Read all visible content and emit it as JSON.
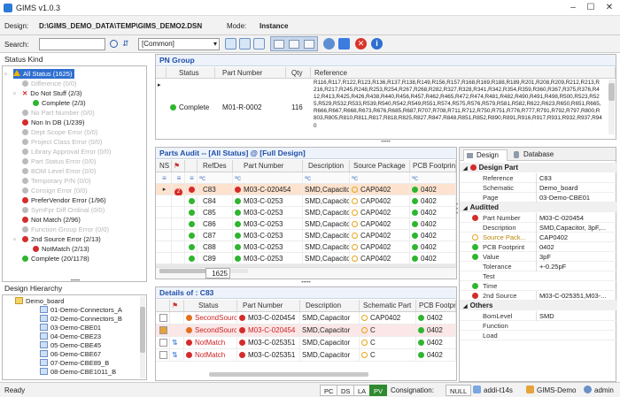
{
  "window": {
    "title": "GIMS v1.0.3"
  },
  "info": {
    "design_label": "Design:",
    "design_path": "D:\\GIMS_DEMO_DATA\\TEMP\\GIMS_DEMO2.DSN",
    "mode_label": "Mode:",
    "mode_value": "Instance"
  },
  "search": {
    "label": "Search:",
    "value": "",
    "scope": "[Common]"
  },
  "status_kind": {
    "title": "Status Kind",
    "items": [
      {
        "label": "All Status (1625)",
        "icon": "warning",
        "dim": false
      },
      {
        "label": "Difference (0/0)",
        "icon": "dot-orange",
        "dim": true
      },
      {
        "label": "Do Not Stuff (2/3)",
        "icon": "x-mark",
        "dim": false
      },
      {
        "label": "Complete (2/3)",
        "icon": "dot-green",
        "dim": false
      },
      {
        "label": "No Part Number (0/0)",
        "icon": "dot-red",
        "dim": true
      },
      {
        "label": "Non In DB (1/239)",
        "icon": "dot-red",
        "dim": false
      },
      {
        "label": "Dept Scope Error (0/0)",
        "icon": "dot-red",
        "dim": true
      },
      {
        "label": "Project Class Error (0/0)",
        "icon": "dot-red",
        "dim": true
      },
      {
        "label": "Library Approval Error (0/0)",
        "icon": "dot-red",
        "dim": true
      },
      {
        "label": "Part Status Error (0/0)",
        "icon": "dot-red",
        "dim": true
      },
      {
        "label": "BOM Level Error (0/0)",
        "icon": "dot-red",
        "dim": true
      },
      {
        "label": "Temporary P/N (0/0)",
        "icon": "dot-red",
        "dim": true
      },
      {
        "label": "Consign Error (0/0)",
        "icon": "dot-red",
        "dim": true
      },
      {
        "label": "PreferVendor Error (1/96)",
        "icon": "dot-red",
        "dim": false
      },
      {
        "label": "SymFpr Diff Ordinal (0/0)",
        "icon": "dot-red",
        "dim": true
      },
      {
        "label": "Not Match (2/96)",
        "icon": "dot-red",
        "dim": false
      },
      {
        "label": "Function Group Error (0/0)",
        "icon": "dot-red",
        "dim": true
      },
      {
        "label": "2nd Source Error (2/13)",
        "icon": "dot-red",
        "dim": false
      },
      {
        "label": "NotMatch (2/13)",
        "icon": "dot-red",
        "dim": false
      },
      {
        "label": "Complete (20/1178)",
        "icon": "dot-green",
        "dim": false
      }
    ]
  },
  "design_hierarchy": {
    "title": "Design Hierarchy",
    "items": [
      "Demo_board",
      "01-Demo-Connectors_A",
      "02-Demo-Connectors_B",
      "03-Demo-CBE01",
      "04-Demo-CBE23",
      "05-Demo-CBE45",
      "06-Demo-CBE67",
      "07-Demo-CBE89_B",
      "08-Demo-CBE1011_B"
    ]
  },
  "pn_group": {
    "title": "PN Group",
    "headers": [
      "Status",
      "Part Number",
      "Qty",
      "Reference"
    ],
    "row": {
      "status": "Complete",
      "part_number": "M01-R-0002",
      "qty": "116",
      "reference": "R116,R117,R122,R123,R136,R137,R138,R149,R156,R157,R168,R169,R188,R189,R201,R208,R209,R212,R213,R216,R217,R245,R248,R253,R254,R267,R268,R282,R327,R328,R341,R342,R354,R359,R360,R367,R375,R376,R412,R413,R425,R426,R438,R440,R456,R457,R462,R465,R472,R474,R481,R482,R490,R491,R498,R500,R523,R525,R529,R532,R533,R539,R540,R542,R549,R551,R574,R575,R576,R579,R581,R582,R622,R623,R650,R651,R665,R666,R667,R668,R673,R676,R685,R687,R707,R708,R711,R712,R750,R751,R776,R777,R791,R792,R797,R800,R803,R805,R810,R811,R817,R818,R825,R827,R847,R848,R851,R852,R890,R891,R916,R917,R931,R932,R937,R940"
    }
  },
  "parts_audit": {
    "title": "Parts Audit -- [All Status] @ [Full Design]",
    "headers": [
      "NS",
      "RefDes",
      "Part Number",
      "Description",
      "Source Package",
      "PCB Footprint"
    ],
    "rows": [
      {
        "ns": "2",
        "refdes": "C83",
        "part": "M03-C-020454",
        "desc": "SMD,Capacitor",
        "pkg": "CAP0402",
        "fp": "0402",
        "status": "red",
        "selected": true
      },
      {
        "ns": "",
        "refdes": "C84",
        "part": "M03-C-0253",
        "desc": "SMD,Capacitor",
        "pkg": "CAP0402",
        "fp": "0402",
        "status": "green",
        "selected": false
      },
      {
        "ns": "",
        "refdes": "C85",
        "part": "M03-C-0253",
        "desc": "SMD,Capacitor",
        "pkg": "CAP0402",
        "fp": "0402",
        "status": "green",
        "selected": false
      },
      {
        "ns": "",
        "refdes": "C86",
        "part": "M03-C-0253",
        "desc": "SMD,Capacitor",
        "pkg": "CAP0402",
        "fp": "0402",
        "status": "green",
        "selected": false
      },
      {
        "ns": "",
        "refdes": "C87",
        "part": "M03-C-0253",
        "desc": "SMD,Capacitor",
        "pkg": "CAP0402",
        "fp": "0402",
        "status": "green",
        "selected": false
      },
      {
        "ns": "",
        "refdes": "C88",
        "part": "M03-C-0253",
        "desc": "SMD,Capacitor",
        "pkg": "CAP0402",
        "fp": "0402",
        "status": "green",
        "selected": false
      },
      {
        "ns": "",
        "refdes": "C89",
        "part": "M03-C-0253",
        "desc": "SMD,Capacitor",
        "pkg": "CAP0402",
        "fp": "0402",
        "status": "green",
        "selected": false
      }
    ],
    "count": "1625"
  },
  "details": {
    "title": "Details of : C83",
    "headers": [
      "Status",
      "Part Number",
      "Description",
      "Schematic Part",
      "PCB Footprint"
    ],
    "rows": [
      {
        "status": "SecondSource",
        "part": "M03-C-020454",
        "desc": "SMD,Capacitor",
        "schpart": "CAP0402",
        "fp": "0402",
        "highlight": false
      },
      {
        "status": "SecondSource",
        "part": "M03-C-020454",
        "desc": "SMD,Capacitor",
        "schpart": "C",
        "fp": "0402",
        "highlight": true
      },
      {
        "status": "NotMatch",
        "part": "M03-C-025351",
        "desc": "SMD,Capacitor",
        "schpart": "C",
        "fp": "0402",
        "highlight": false
      },
      {
        "status": "NotMatch",
        "part": "M03-C-025351",
        "desc": "SMD,Capacitor",
        "schpart": "C",
        "fp": "0402",
        "highlight": false
      }
    ]
  },
  "props": {
    "tabs": [
      "Design",
      "Database"
    ],
    "design_part": {
      "title": "Design Part",
      "rows": [
        [
          "Reference",
          "C83"
        ],
        [
          "Schematic",
          "Demo_board"
        ],
        [
          "Page",
          "03-Demo-CBE01"
        ]
      ]
    },
    "auditted": {
      "title": "Auditted",
      "rows": [
        [
          "Part Number",
          "M03-C-020454"
        ],
        [
          "Description",
          "SMD,Capacitor, 3pF,..."
        ],
        [
          "Source Pack...",
          "CAP0402"
        ],
        [
          "PCB Footprint",
          "0402"
        ],
        [
          "Value",
          "3pF"
        ],
        [
          "Tolerance",
          "+-0.25pF"
        ],
        [
          "Test",
          ""
        ],
        [
          "Time",
          ""
        ],
        [
          "2nd Source",
          "M03-C-025351,M03-..."
        ]
      ]
    },
    "others": {
      "title": "Others",
      "rows": [
        [
          "BomLevel",
          "SMD"
        ],
        [
          "Function",
          ""
        ],
        [
          "Load",
          ""
        ]
      ]
    }
  },
  "statusbar": {
    "ready": "Ready",
    "toggles": [
      "PC",
      "DS",
      "LA",
      "PV"
    ],
    "consignation_label": "Consignation:",
    "consignation_value": "NULL",
    "host": "addi-t14s",
    "design": "GIMS-Demo",
    "user": "admin"
  }
}
